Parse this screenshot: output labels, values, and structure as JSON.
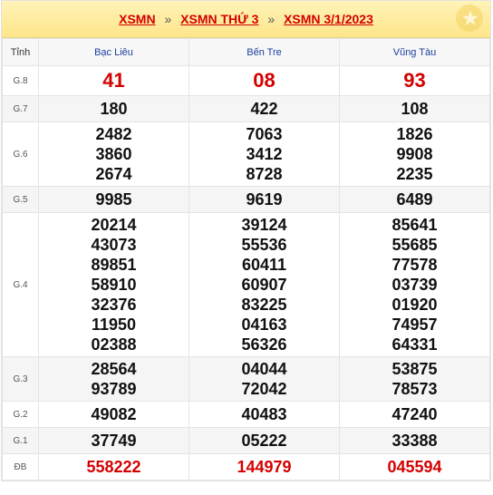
{
  "header": {
    "crumbs": [
      "XSMN",
      "XSMN THỨ 3",
      "XSMN 3/1/2023"
    ],
    "separator": "»"
  },
  "columns": [
    "Tỉnh",
    "Bạc Liêu",
    "Bến Tre",
    "Vũng Tàu"
  ],
  "rows": [
    {
      "label": "G.8",
      "values": [
        [
          "41"
        ],
        [
          "08"
        ],
        [
          "93"
        ]
      ]
    },
    {
      "label": "G.7",
      "values": [
        [
          "180"
        ],
        [
          "422"
        ],
        [
          "108"
        ]
      ]
    },
    {
      "label": "G.6",
      "values": [
        [
          "2482",
          "3860",
          "2674"
        ],
        [
          "7063",
          "3412",
          "8728"
        ],
        [
          "1826",
          "9908",
          "2235"
        ]
      ]
    },
    {
      "label": "G.5",
      "values": [
        [
          "9985"
        ],
        [
          "9619"
        ],
        [
          "6489"
        ]
      ]
    },
    {
      "label": "G.4",
      "values": [
        [
          "20214",
          "43073",
          "89851",
          "58910",
          "32376",
          "11950",
          "02388"
        ],
        [
          "39124",
          "55536",
          "60411",
          "60907",
          "83225",
          "04163",
          "56326"
        ],
        [
          "85641",
          "55685",
          "77578",
          "03739",
          "01920",
          "74957",
          "64331"
        ]
      ]
    },
    {
      "label": "G.3",
      "values": [
        [
          "28564",
          "93789"
        ],
        [
          "04044",
          "72042"
        ],
        [
          "53875",
          "78573"
        ]
      ]
    },
    {
      "label": "G.2",
      "values": [
        [
          "49082"
        ],
        [
          "40483"
        ],
        [
          "47240"
        ]
      ]
    },
    {
      "label": "G.1",
      "values": [
        [
          "37749"
        ],
        [
          "05222"
        ],
        [
          "33388"
        ]
      ]
    },
    {
      "label": "ĐB",
      "values": [
        [
          "558222"
        ],
        [
          "144979"
        ],
        [
          "045594"
        ]
      ]
    }
  ],
  "colors": {
    "accent": "#d40000",
    "province": "#1c3e9e"
  }
}
